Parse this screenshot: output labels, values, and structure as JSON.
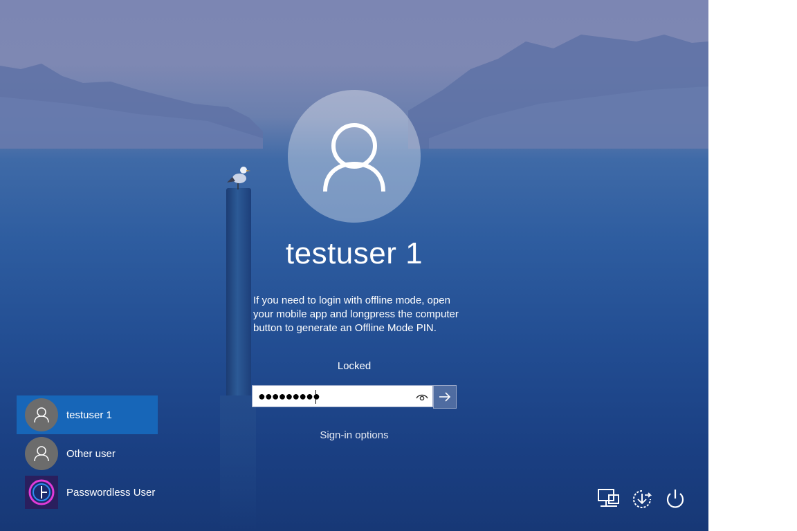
{
  "login": {
    "username": "testuser 1",
    "info": "If you need to login with offline mode, open your mobile app and longpress the computer button to generate an Offline Mode PIN.",
    "status": "Locked",
    "password_value": "●●●●●●●●●",
    "signin_options": "Sign-in options"
  },
  "users": [
    {
      "name": "testuser 1",
      "selected": true
    },
    {
      "name": "Other user",
      "selected": false
    },
    {
      "name": "Passwordless User",
      "selected": false
    }
  ],
  "system_icons": [
    "network-icon",
    "accessibility-icon",
    "power-icon"
  ],
  "colors": {
    "selected_user": "#1766b8",
    "text": "#ffffff"
  }
}
